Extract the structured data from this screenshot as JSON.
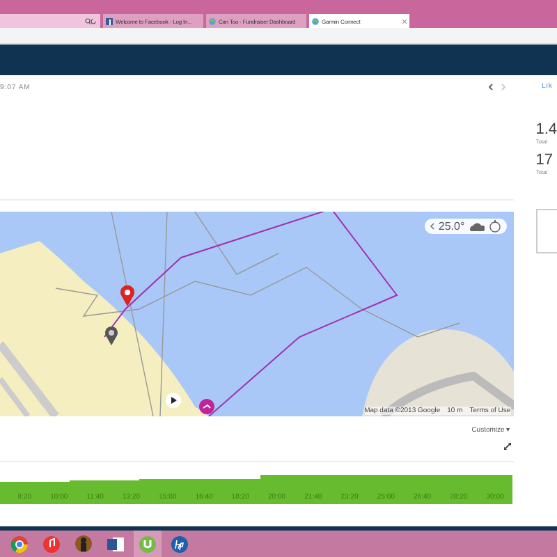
{
  "browser": {
    "tabs": [
      {
        "title": "Welcome to Facebook - Log In...",
        "kind": "facebook",
        "selected": false
      },
      {
        "title": "Can Too - Fundraiser Dashboard",
        "kind": "globe",
        "selected": false
      },
      {
        "title": "Garmin Connect",
        "kind": "globe",
        "selected": true
      }
    ]
  },
  "activity": {
    "time": "9:07 AM",
    "like": "Lik"
  },
  "stats": [
    {
      "value": "1.4",
      "label": "Total"
    },
    {
      "value": "17",
      "label": "Total"
    }
  ],
  "map": {
    "temperature": "25.0°",
    "attribution": "Map data ©2013 Google",
    "scale": "10 m",
    "terms": "Terms of Use"
  },
  "customize": "Customize ▾",
  "timeline": {
    "labels": [
      "8:20",
      "10:00",
      "11:40",
      "13:20",
      "15:00",
      "16:40",
      "18:20",
      "20:00",
      "21:40",
      "23:20",
      "25:00",
      "26:40",
      "28:20",
      "30:00"
    ]
  },
  "taskbar": [
    {
      "kind": "chrome"
    },
    {
      "kind": "itunes"
    },
    {
      "kind": "figure"
    },
    {
      "kind": "word"
    },
    {
      "kind": "torrent",
      "selected": true
    },
    {
      "kind": "hp",
      "selected": false
    }
  ]
}
